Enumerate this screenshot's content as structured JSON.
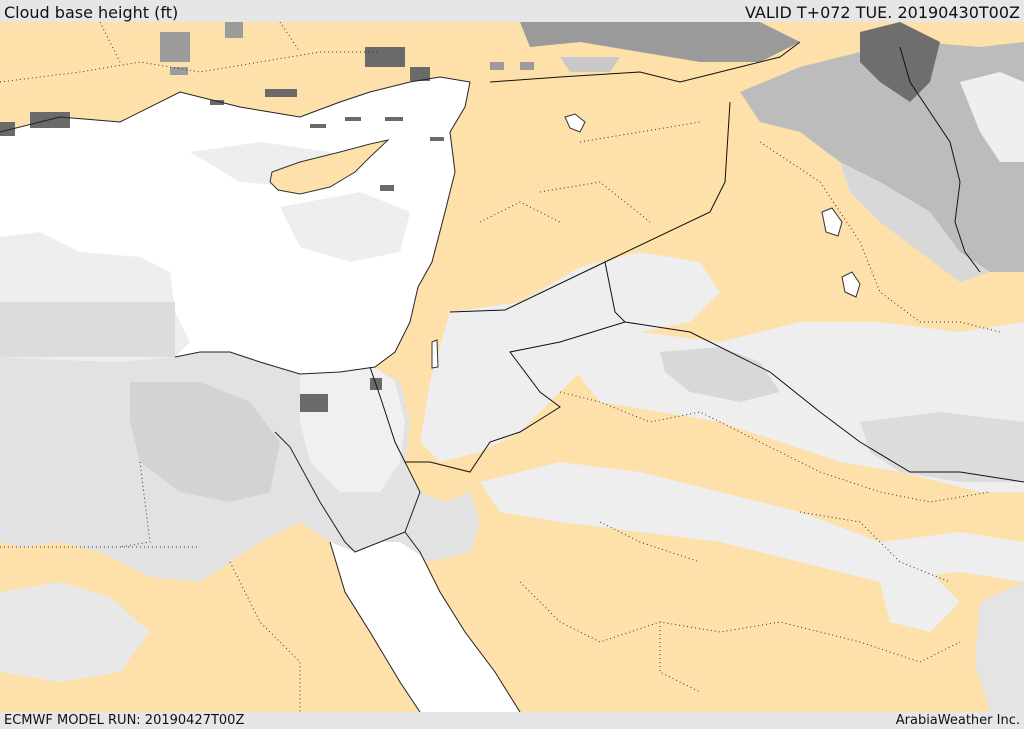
{
  "header": {
    "title": "Cloud base height (ft)",
    "valid": "VALID T+072 TUE. 20190430T00Z"
  },
  "footer": {
    "model_run": "ECMWF MODEL RUN: 20190427T00Z",
    "credit": "ArabiaWeather Inc."
  },
  "colors": {
    "land_clear": "#fde0aa",
    "sea": "#ffffff",
    "cloud_light": "#eeeeee",
    "cloud_mid": "#d6d6d6",
    "cloud_dark": "#8c8c8c",
    "cloud_darkest": "#5a5a5a"
  }
}
